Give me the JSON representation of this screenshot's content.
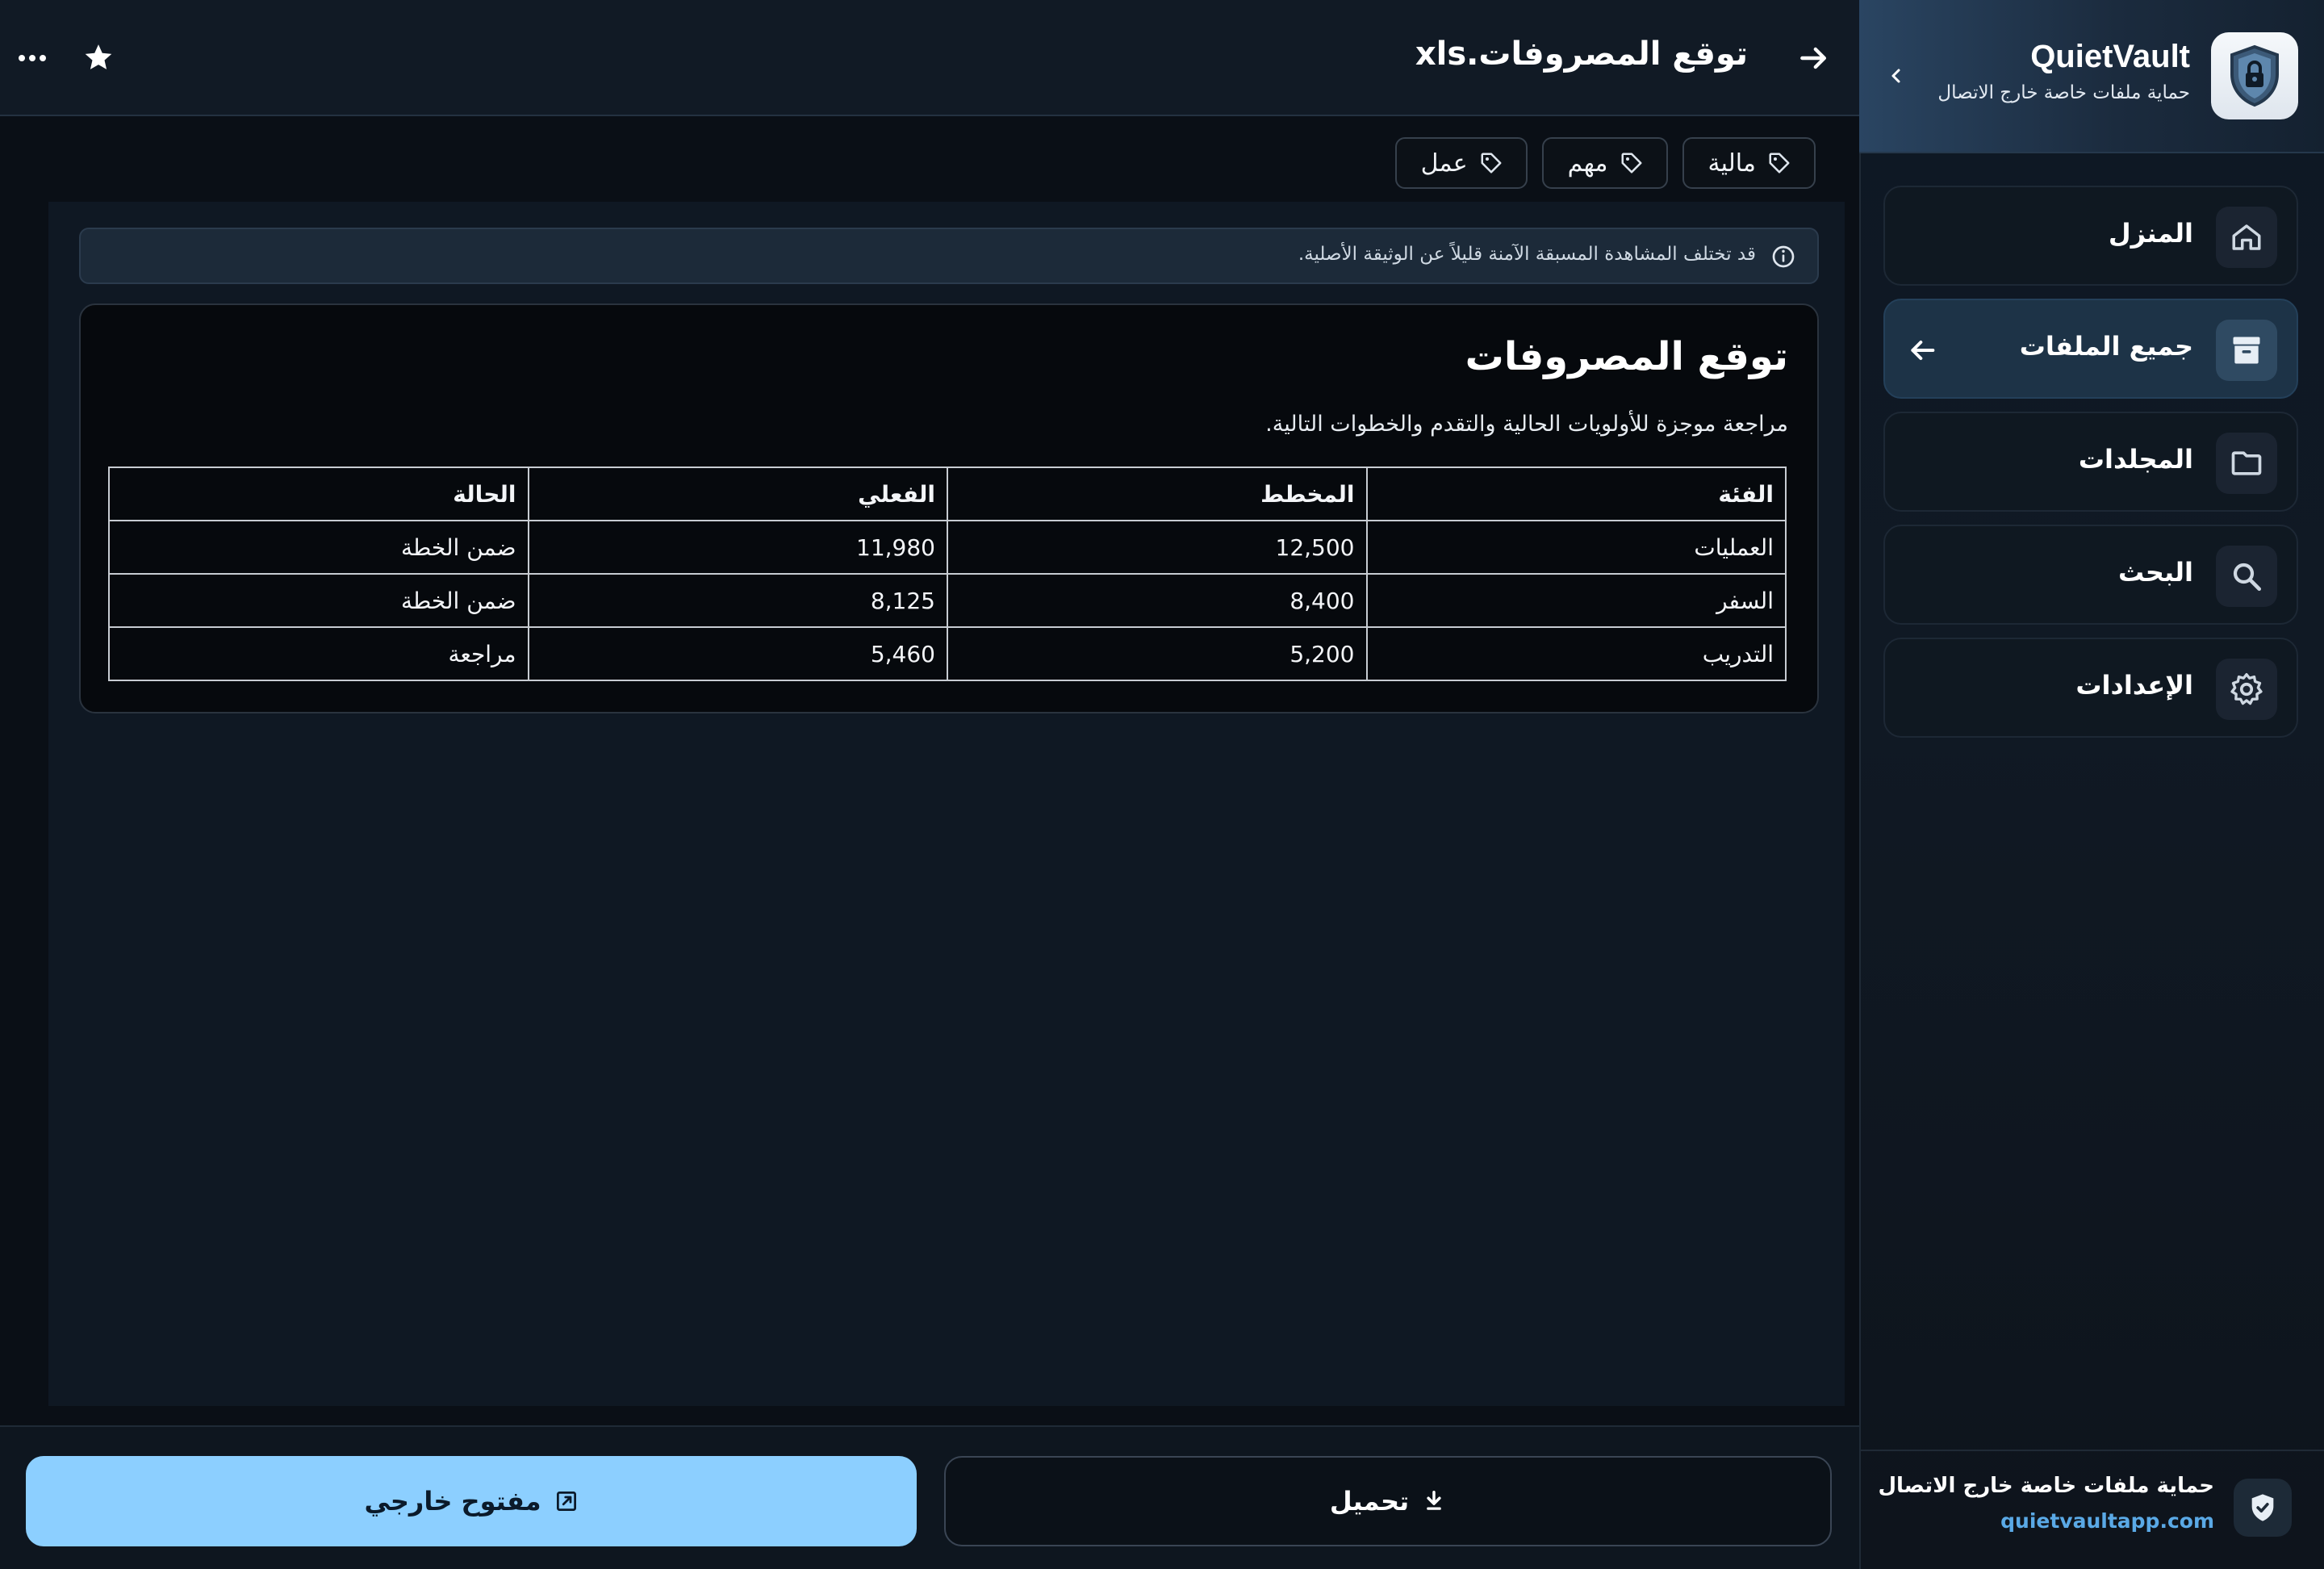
{
  "brand": {
    "name": "QuietVault",
    "tagline": "حماية ملفات خاصة خارج الاتصال"
  },
  "nav": {
    "items": [
      {
        "label": "المنزل",
        "icon": "home-icon"
      },
      {
        "label": "جميع الملفات",
        "icon": "archive-icon",
        "active": true
      },
      {
        "label": "المجلدات",
        "icon": "folder-icon"
      },
      {
        "label": "البحث",
        "icon": "search-icon"
      },
      {
        "label": "الإعدادات",
        "icon": "gear-icon"
      }
    ]
  },
  "footer": {
    "text": "حماية ملفات خاصة خارج الاتصال",
    "link": "quietvaultapp.com"
  },
  "header": {
    "title": "توقع المصروفات.xls"
  },
  "tags": [
    "مالية",
    "مهم",
    "عمل"
  ],
  "notice": {
    "text": "قد تختلف المشاهدة المسبقة الآمنة قليلاً عن الوثيقة الأصلية."
  },
  "document": {
    "title": "توقع المصروفات",
    "subtitle": "مراجعة موجزة للأولويات الحالية والتقدم والخطوات التالية.",
    "columns": [
      "الفئة",
      "المخطط",
      "الفعلي",
      "الحالة"
    ],
    "rows": [
      [
        "العمليات",
        "12,500",
        "11,980",
        "ضمن الخطة"
      ],
      [
        "السفر",
        "8,400",
        "8,125",
        "ضمن الخطة"
      ],
      [
        "التدريب",
        "5,200",
        "5,460",
        "مراجعة"
      ]
    ]
  },
  "actions": {
    "download": "تحميل",
    "open_external": "مفتوح خارجي"
  },
  "colors": {
    "accent": "#8ccfff",
    "link": "#5aa9e6",
    "active_nav": "#1d3347"
  }
}
